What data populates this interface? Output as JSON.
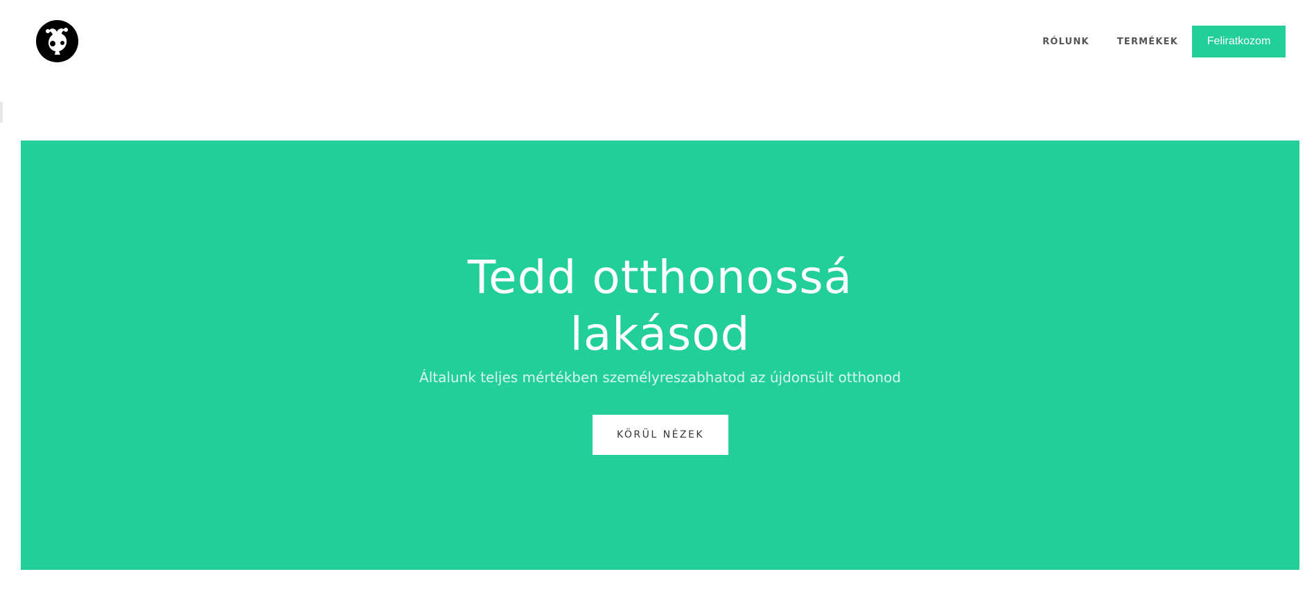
{
  "header": {
    "logo_icon": "jester-head-logo-icon",
    "nav": {
      "about": "RÓLUNK",
      "products": "TERMÉKEK",
      "subscribe": "Feliratkozom"
    }
  },
  "hero": {
    "title_line1": "Tedd otthonossá",
    "title_line2": "lakásod",
    "subtitle": "Általunk teljes mértékben személyreszabhatod az újdonsült otthonod",
    "button": "KÖRÜL NÉZEK"
  },
  "colors": {
    "accent": "#22cf98",
    "background": "#ffffff",
    "nav_text": "#555555"
  }
}
